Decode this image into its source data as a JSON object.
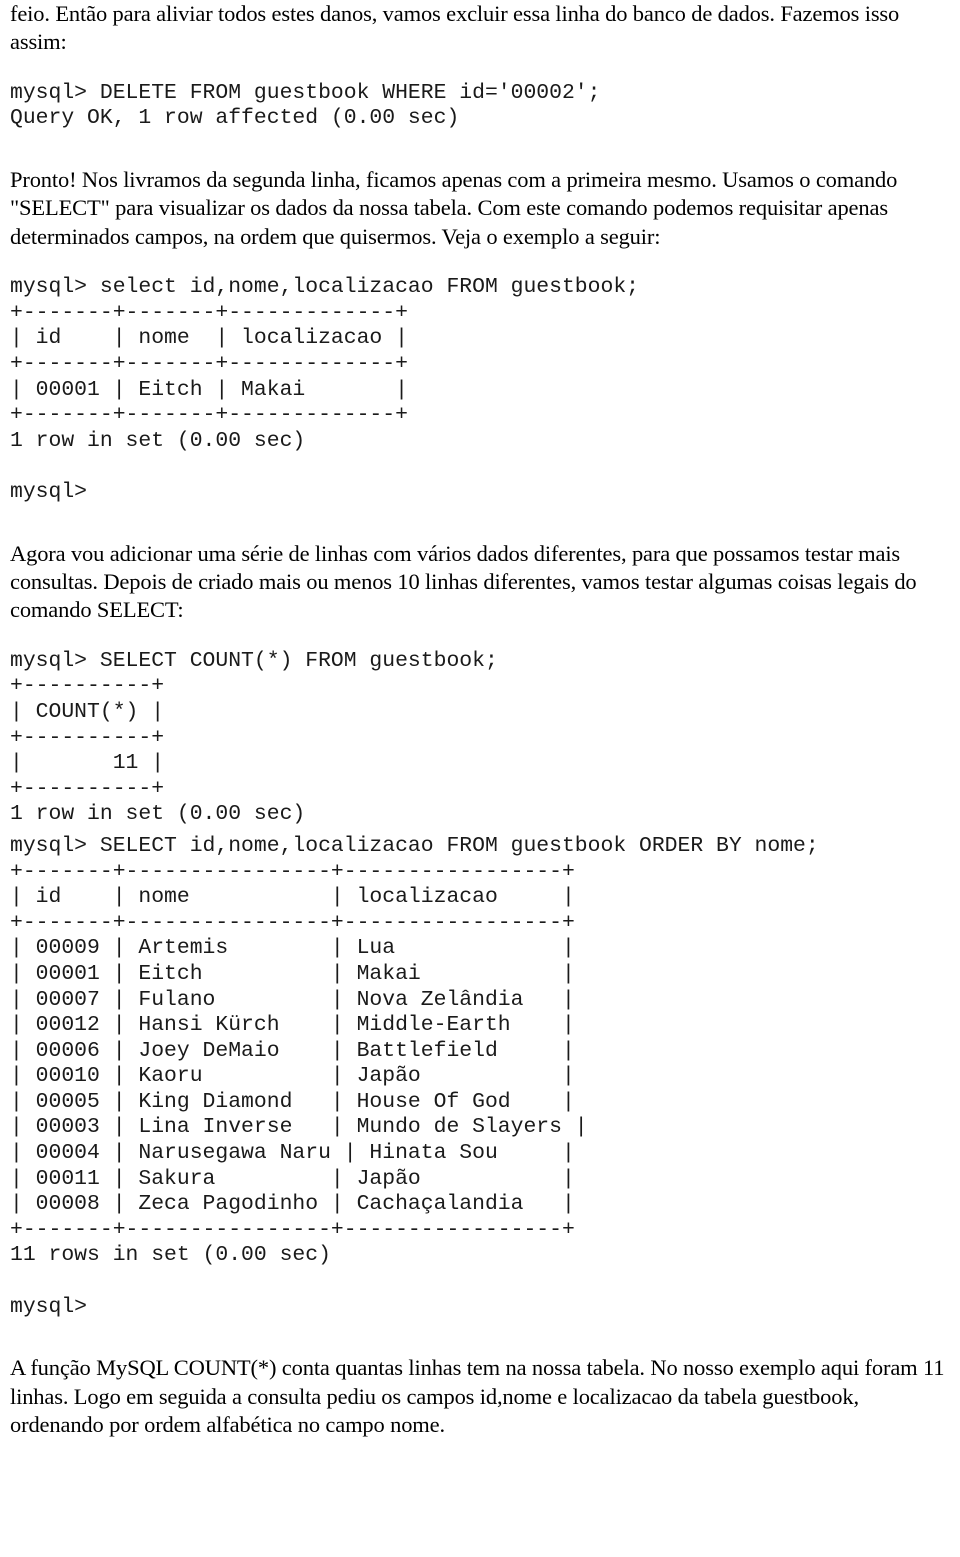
{
  "document": {
    "language": "pt-BR",
    "text_color": "#000000",
    "background_color": "#ffffff",
    "paragraph_1": "feio. Então para aliviar todos estes danos, vamos excluir essa linha do banco de dados. Fazemos isso assim:",
    "paragraph_2": "Pronto! Nos livramos da segunda linha, ficamos apenas com a primeira mesmo. Usamos o comando \"SELECT\" para visualizar os dados da nossa tabela. Com este comando podemos requisitar apenas determinados campos, na ordem que quisermos. Veja o exemplo a seguir:",
    "paragraph_3": "Agora vou adicionar uma série de linhas com vários dados diferentes, para que possamos testar mais consultas. Depois de criado mais ou menos 10 linhas diferentes, vamos testar algumas coisas legais do comando SELECT:",
    "paragraph_4": "A função MySQL COUNT(*) conta quantas linhas tem na nossa tabela. No nosso exemplo aqui foram 11 linhas. Logo em seguida a consulta pediu os campos id,nome e localizacao da tabela guestbook, ordenando por ordem alfabética no campo nome."
  },
  "console_block_1": {
    "prompt": "mysql>",
    "command": "DELETE FROM guestbook WHERE id='00002';",
    "result_status": "Query OK, 1 row affected (0.00 sec)",
    "text": "mysql> DELETE FROM guestbook WHERE id='00002';\nQuery OK, 1 row affected (0.00 sec)"
  },
  "console_block_2": {
    "prompt": "mysql>",
    "command": "select id,nome,localizacao FROM guestbook;",
    "columns": [
      "id",
      "nome",
      "localizacao"
    ],
    "rows": [
      [
        "00001",
        "Eitch",
        "Makai"
      ]
    ],
    "result_status": "1 row in set (0.00 sec)",
    "trailing_prompt": "mysql>",
    "text": "mysql> select id,nome,localizacao FROM guestbook;\n+-------+-------+-------------+\n| id    | nome  | localizacao |\n+-------+-------+-------------+\n| 00001 | Eitch | Makai       |\n+-------+-------+-------------+\n1 row in set (0.00 sec)\n\nmysql>"
  },
  "console_block_3": {
    "prompt": "mysql>",
    "command": "SELECT COUNT(*) FROM guestbook;",
    "columns": [
      "COUNT(*)"
    ],
    "rows": [
      [
        "11"
      ]
    ],
    "result_status": "1 row in set (0.00 sec)",
    "text": "mysql> SELECT COUNT(*) FROM guestbook;\n+----------+\n| COUNT(*) |\n+----------+\n|       11 |\n+----------+\n1 row in set (0.00 sec)"
  },
  "console_block_4": {
    "prompt": "mysql>",
    "command": "SELECT id,nome,localizacao FROM guestbook ORDER BY nome;",
    "columns": [
      "id",
      "nome",
      "localizacao"
    ],
    "rows": [
      [
        "00009",
        "Artemis",
        "Lua"
      ],
      [
        "00001",
        "Eitch",
        "Makai"
      ],
      [
        "00007",
        "Fulano",
        "Nova Zelândia"
      ],
      [
        "00012",
        "Hansi Kürch",
        "Middle-Earth"
      ],
      [
        "00006",
        "Joey DeMaio",
        "Battlefield"
      ],
      [
        "00010",
        "Kaoru",
        "Japão"
      ],
      [
        "00005",
        "King Diamond",
        "House Of God"
      ],
      [
        "00003",
        "Lina Inverse",
        "Mundo de Slayers"
      ],
      [
        "00004",
        "Narusegawa Naru",
        "Hinata Sou"
      ],
      [
        "00011",
        "Sakura",
        "Japão"
      ],
      [
        "00008",
        "Zeca Pagodinho",
        "Cachaçalandia"
      ]
    ],
    "result_status": "11 rows in set (0.00 sec)",
    "trailing_prompt": "mysql>",
    "text": "mysql> SELECT id,nome,localizacao FROM guestbook ORDER BY nome;\n+-------+----------------+-----------------+\n| id    | nome           | localizacao     |\n+-------+----------------+-----------------+\n| 00009 | Artemis        | Lua             |\n| 00001 | Eitch          | Makai           |\n| 00007 | Fulano         | Nova Zelândia   |\n| 00012 | Hansi Kürch    | Middle-Earth    |\n| 00006 | Joey DeMaio    | Battlefield     |\n| 00010 | Kaoru          | Japão           |\n| 00005 | King Diamond   | House Of God    |\n| 00003 | Lina Inverse   | Mundo de Slayers |\n| 00004 | Narusegawa Naru | Hinata Sou     |\n| 00011 | Sakura         | Japão           |\n| 00008 | Zeca Pagodinho | Cachaçalandia   |\n+-------+----------------+-----------------+\n11 rows in set (0.00 sec)\n\nmysql>"
  }
}
